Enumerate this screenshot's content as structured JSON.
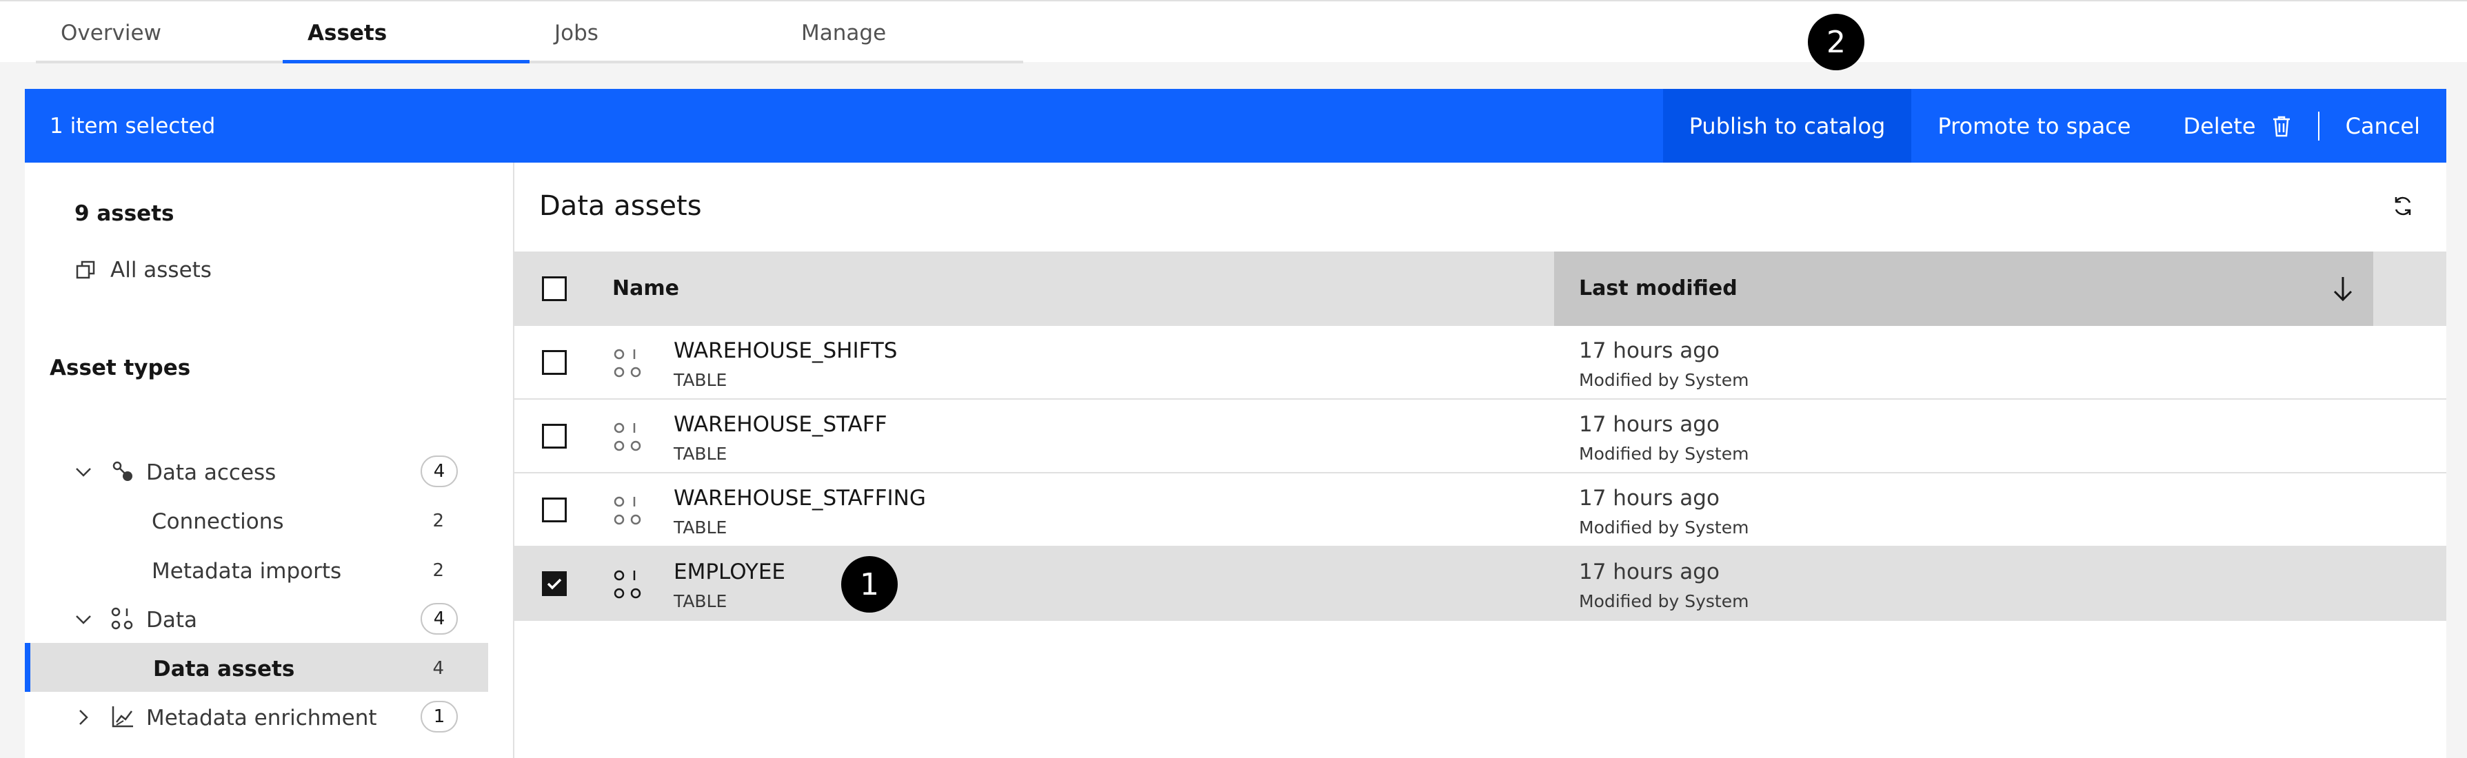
{
  "tabs": [
    "Overview",
    "Assets",
    "Jobs",
    "Manage"
  ],
  "active_tab": "Assets",
  "callouts": [
    "1",
    "2"
  ],
  "action_bar": {
    "selected_text": "1 item selected",
    "publish": "Publish to catalog",
    "promote": "Promote to space",
    "delete": "Delete",
    "cancel": "Cancel",
    "bg_color": "#0f62fe"
  },
  "sidebar": {
    "count": "9 assets",
    "all_assets": "All assets",
    "asset_types": "Asset types",
    "data_access": {
      "label": "Data access",
      "count": "4"
    },
    "connections": {
      "label": "Connections",
      "count": "2"
    },
    "metadata_imports": {
      "label": "Metadata imports",
      "count": "2"
    },
    "data": {
      "label": "Data",
      "count": "4"
    },
    "data_assets": {
      "label": "Data assets",
      "count": "4"
    },
    "metadata_enrichment": {
      "label": "Metadata enrichment",
      "count": "1"
    }
  },
  "main": {
    "title": "Data assets",
    "columns": {
      "name": "Name",
      "last_modified": "Last modified"
    },
    "rows": [
      {
        "name": "WAREHOUSE_SHIFTS",
        "type": "TABLE",
        "modified": "17 hours ago",
        "modified_by": "Modified by System",
        "checked": false
      },
      {
        "name": "WAREHOUSE_STAFF",
        "type": "TABLE",
        "modified": "17 hours ago",
        "modified_by": "Modified by System",
        "checked": false
      },
      {
        "name": "WAREHOUSE_STAFFING",
        "type": "TABLE",
        "modified": "17 hours ago",
        "modified_by": "Modified by System",
        "checked": false
      },
      {
        "name": "EMPLOYEE",
        "type": "TABLE",
        "modified": "17 hours ago",
        "modified_by": "Modified by System",
        "checked": true
      }
    ]
  }
}
